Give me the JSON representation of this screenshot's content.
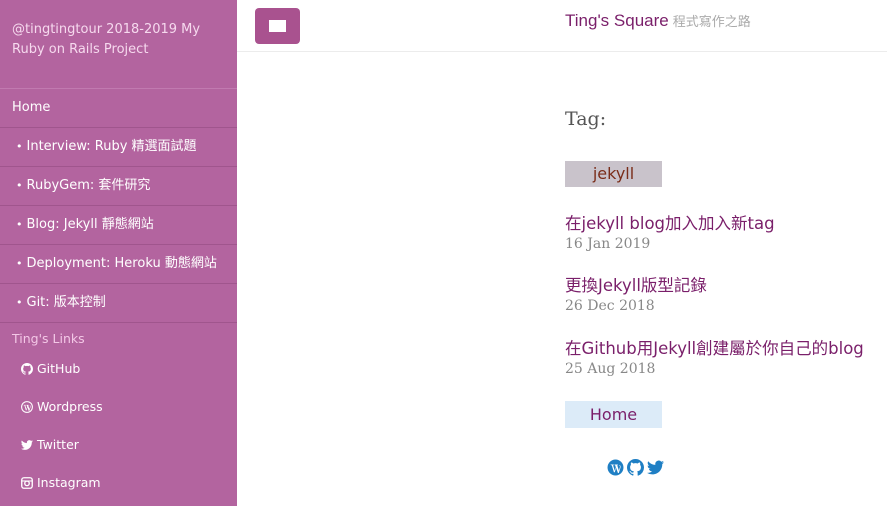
{
  "sidebar": {
    "title": "@tingtingtour 2018-2019 My Ruby on Rails Project",
    "nav": [
      {
        "label": "Home",
        "sub": false
      },
      {
        "label": "Interview: Ruby 精選面試題",
        "sub": true
      },
      {
        "label": "RubyGem: 套件研究",
        "sub": true
      },
      {
        "label": "Blog: Jekyll 靜態網站",
        "sub": true
      },
      {
        "label": "Deployment: Heroku 動態網站",
        "sub": true
      },
      {
        "label": "Git: 版本控制",
        "sub": true
      }
    ],
    "bullet": "•",
    "links_header": "Ting's Links",
    "links": [
      {
        "label": "GitHub",
        "icon": "github-icon"
      },
      {
        "label": "Wordpress",
        "icon": "wordpress-icon"
      },
      {
        "label": "Twitter",
        "icon": "twitter-icon"
      },
      {
        "label": "Instagram",
        "icon": "instagram-icon"
      }
    ]
  },
  "header": {
    "brand_name": "Ting's Square",
    "brand_tagline": "程式寫作之路"
  },
  "main": {
    "tag_heading": "Tag:",
    "tag_name": "jekyll",
    "posts": [
      {
        "title": "在jekyll blog加入加入新tag",
        "date": "16 Jan 2019"
      },
      {
        "title": "更換Jekyll版型記錄",
        "date": "26 Dec 2018"
      },
      {
        "title": "在Github用Jekyll創建屬於你自己的blog",
        "date": "25 Aug 2018"
      }
    ],
    "home_button": "Home",
    "social_icons": [
      "wordpress-icon",
      "github-icon",
      "twitter-icon"
    ]
  },
  "colors": {
    "sidebar_bg": "#b3649f",
    "accent": "#7a1f6a",
    "menu_button": "#a9528f",
    "social_icon": "#1f7fc4"
  }
}
